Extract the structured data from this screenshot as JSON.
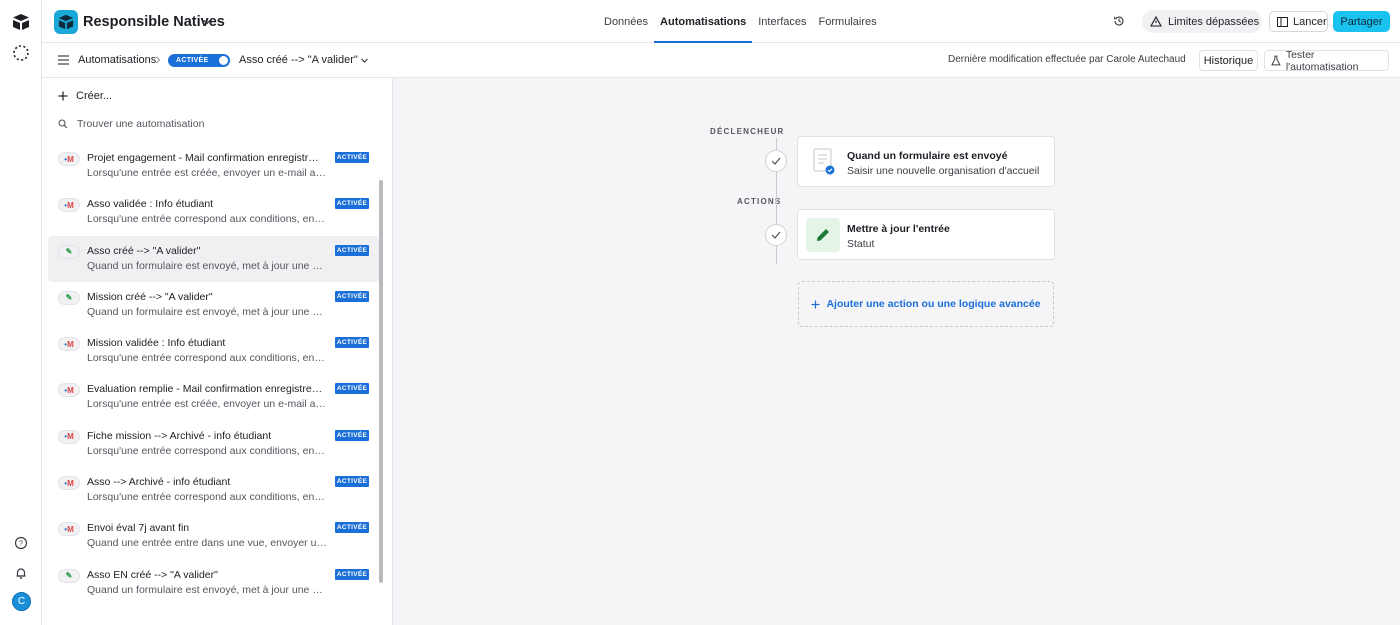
{
  "app": {
    "base_name": "Responsible Natives",
    "nav_tabs": [
      {
        "label": "Données"
      },
      {
        "label": "Automatisations"
      },
      {
        "label": "Interfaces"
      },
      {
        "label": "Formulaires"
      }
    ],
    "limits_label": "Limites dépassées",
    "launch_label": "Lancer",
    "share_label": "Partager",
    "avatar_letter": "C",
    "accent_color": "#1a6fd8"
  },
  "subbar": {
    "breadcrumb": "Automatisations",
    "toggle_label": "ACTIVÉE",
    "automation_title": "Asso créé --> \"A valider\"",
    "last_modified": "Dernière modification effectuée par Carole Autechaud",
    "history_label": "Historique",
    "test_label": "Tester l'automatisation"
  },
  "panel": {
    "create_label": "Créer...",
    "search_placeholder": "Trouver une automatisation",
    "items": [
      {
        "icon": "gmail",
        "name": "Projet engagement - Mail confirmation enregistrment",
        "desc": "Lorsqu'une entrée est créée, envoyer un e-mail avec...",
        "badge": "ACTIVÉE"
      },
      {
        "icon": "gmail",
        "name": "Asso validée : Info étudiant",
        "desc": "Lorsqu'une entrée correspond aux conditions, envoyer...",
        "badge": "ACTIVÉE"
      },
      {
        "icon": "edit",
        "name": "Asso créé --> \"A valider\"",
        "desc": "Quand un formulaire est envoyé, met à jour une entrée",
        "badge": "ACTIVÉE"
      },
      {
        "icon": "edit",
        "name": "Mission créé --> \"A valider\"",
        "desc": "Quand un formulaire est envoyé, met à jour une entrée",
        "badge": "ACTIVÉE"
      },
      {
        "icon": "gmail",
        "name": "Mission validée : Info étudiant",
        "desc": "Lorsqu'une entrée correspond aux conditions, envoyer...",
        "badge": "ACTIVÉE"
      },
      {
        "icon": "gmail",
        "name": "Evaluation remplie - Mail confirmation enregistrement",
        "desc": "Lorsqu'une entrée est créée, envoyer un e-mail avec...",
        "badge": "ACTIVÉE"
      },
      {
        "icon": "gmail",
        "name": "Fiche mission --> Archivé - info étudiant",
        "desc": "Lorsqu'une entrée correspond aux conditions, envoyer...",
        "badge": "ACTIVÉE"
      },
      {
        "icon": "gmail",
        "name": "Asso --> Archivé - info étudiant",
        "desc": "Lorsqu'une entrée correspond aux conditions, envoyer...",
        "badge": "ACTIVÉE"
      },
      {
        "icon": "gmail",
        "name": "Envoi éval 7j avant fin",
        "desc": "Quand une entrée entre dans une vue, envoyer un e-mail",
        "badge": "ACTIVÉE"
      },
      {
        "icon": "edit",
        "name": "Asso EN créé --> \"A valider\"",
        "desc": "Quand un formulaire est envoyé, met à jour une entrée",
        "badge": "ACTIVÉE"
      }
    ]
  },
  "canvas": {
    "trigger_label": "DÉCLENCHEUR",
    "actions_label": "ACTIONS",
    "trigger_card": {
      "title": "Quand un formulaire est envoyé",
      "subtitle": "Saisir une nouvelle organisation d'accueil"
    },
    "action_card": {
      "title": "Mettre à jour l'entrée",
      "subtitle": "Statut"
    },
    "add_action_label": "Ajouter une action ou une logique avancée"
  }
}
